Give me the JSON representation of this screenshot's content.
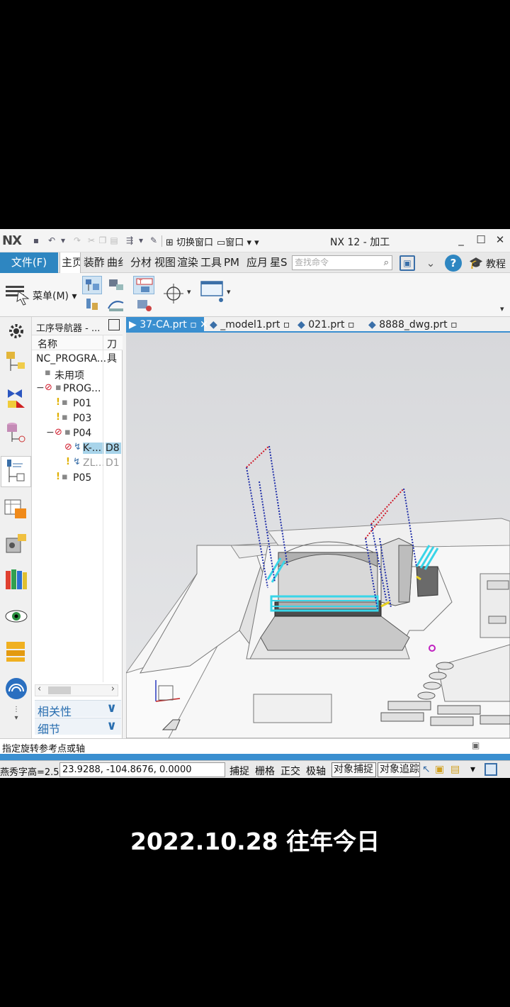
{
  "app": {
    "logo": "NX",
    "window_title": "NX 12 - 加工",
    "quick_access": {
      "switch_window": "切换窗口",
      "window_menu": "窗口"
    },
    "window_controls": {
      "minimize": "_",
      "maximize": "☐",
      "close": "✕"
    }
  },
  "ribbon": {
    "file_tab": "文件(F)",
    "tabs": [
      "主页",
      "装配",
      "曲线",
      "分析",
      "视图",
      "渲染",
      "工具",
      "PM",
      "应用",
      "星空"
    ],
    "tab_display": [
      "主页",
      "装酢",
      "曲纟",
      "分材",
      "视图",
      "渲染",
      "工具",
      "PM",
      "应月",
      "星S"
    ],
    "search_placeholder": "查找命令",
    "tutorial": "教程",
    "menu_button": "菜单(M)"
  },
  "navigator": {
    "title": "工序导航器 - ...",
    "col_name": "名称",
    "col_tool": "刀具",
    "rows": [
      {
        "label": "NC_PROGRA...",
        "tool": ""
      },
      {
        "label": "未用项",
        "tool": ""
      },
      {
        "label": "PROG...",
        "tool": ""
      },
      {
        "label": "P01",
        "tool": ""
      },
      {
        "label": "P03",
        "tool": ""
      },
      {
        "label": "P04",
        "tool": ""
      },
      {
        "label": "K-...",
        "tool": "D8"
      },
      {
        "label": "ZL...",
        "tool": "D1"
      },
      {
        "label": "P05",
        "tool": ""
      }
    ],
    "panels": {
      "dependencies": "相关性",
      "details": "细节"
    }
  },
  "doc_tabs": [
    {
      "label": "37-CA.prt",
      "active": true
    },
    {
      "label": "_model1.prt",
      "active": false
    },
    {
      "label": "021.prt",
      "active": false
    },
    {
      "label": "8888_dwg.prt",
      "active": false
    }
  ],
  "status": {
    "prompt": "指定旋转参考点或轴",
    "font_info": "燕秀字高=2.5",
    "coordinates": "23.9288,   -104.8676,  0.0000",
    "snap_buttons": [
      "捕捉",
      "栅格",
      "正交",
      "极轴",
      "对象捕捉",
      "对象追踪"
    ]
  },
  "caption": "2022.10.28 往年今日",
  "colors": {
    "accent_blue": "#3a8fd0",
    "file_tab": "#2e86c1",
    "toolpath_blue": "#1f2ea8",
    "toolpath_red": "#d01a2a",
    "toolpath_cyan": "#39d5e8"
  }
}
